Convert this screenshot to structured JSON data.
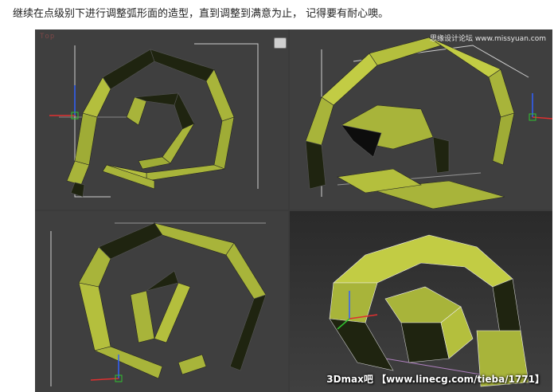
{
  "caption": "继续在点级别下进行调整弧形面的造型，直到调整到满意为止， 记得要有耐心噢。",
  "viewports": [
    {
      "name": "top-left",
      "label": "Top"
    },
    {
      "name": "top-right",
      "label": ""
    },
    {
      "name": "bottom-left",
      "label": ""
    },
    {
      "name": "bottom-right",
      "label": ""
    }
  ],
  "watermark_top": "思缘设计论坛 www.missyuan.com",
  "watermark_bottom": "3Dmax吧 【www.linecg.com/tieba/1771】",
  "colors": {
    "mesh_face": "#a8b43a",
    "mesh_face_light": "#c2cc44",
    "mesh_dark": "#1f2410",
    "viewport_bg": "#3f3f3f",
    "active_bg": "#2e2e2e"
  },
  "icons": {
    "viewport_badge": "view-cube-icon",
    "axis_gizmo": "transform-gizmo-icon"
  }
}
